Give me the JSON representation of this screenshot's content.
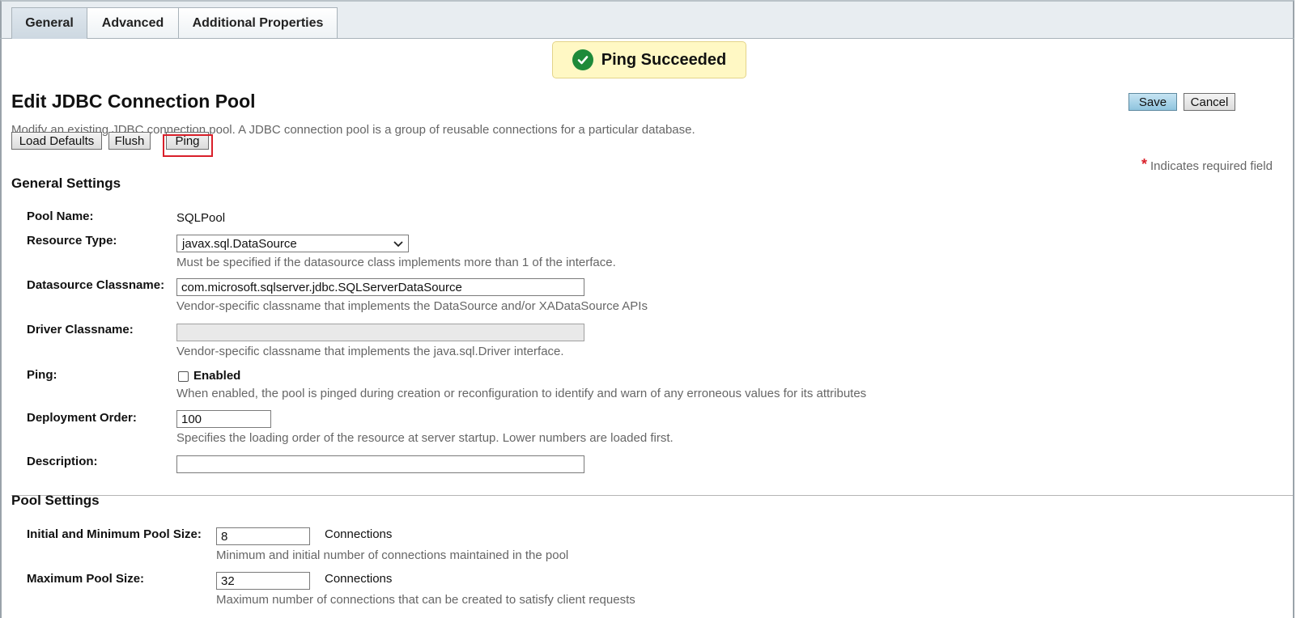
{
  "tabs": [
    {
      "label": "General",
      "active": true
    },
    {
      "label": "Advanced",
      "active": false
    },
    {
      "label": "Additional Properties",
      "active": false
    }
  ],
  "banner": {
    "text": "Ping Succeeded",
    "icon": "check-circle-icon",
    "color": "#1e8a3a"
  },
  "page": {
    "title": "Edit JDBC Connection Pool",
    "description": "Modify an existing JDBC connection pool. A JDBC connection pool is a group of reusable connections for a particular database."
  },
  "actions": {
    "save": "Save",
    "cancel": "Cancel",
    "load_defaults": "Load Defaults",
    "flush": "Flush",
    "ping": "Ping"
  },
  "required_note": {
    "star": "*",
    "text": "Indicates required field"
  },
  "general_settings": {
    "title": "General Settings",
    "pool_name": {
      "label": "Pool Name:",
      "value": "SQLPool"
    },
    "resource_type": {
      "label": "Resource Type:",
      "value": "javax.sql.DataSource",
      "help": "Must be specified if the datasource class implements more than 1 of the interface."
    },
    "datasource_classname": {
      "label": "Datasource Classname:",
      "value": "com.microsoft.sqlserver.jdbc.SQLServerDataSource",
      "help": "Vendor-specific classname that implements the DataSource and/or XADataSource APIs"
    },
    "driver_classname": {
      "label": "Driver Classname:",
      "value": "",
      "help": "Vendor-specific classname that implements the java.sql.Driver interface."
    },
    "ping": {
      "label": "Ping:",
      "checkbox_label": "Enabled",
      "checked": false,
      "help": "When enabled, the pool is pinged during creation or reconfiguration to identify and warn of any erroneous values for its attributes"
    },
    "deployment_order": {
      "label": "Deployment Order:",
      "value": "100",
      "help": "Specifies the loading order of the resource at server startup. Lower numbers are loaded first."
    },
    "description": {
      "label": "Description:",
      "value": ""
    }
  },
  "pool_settings": {
    "title": "Pool Settings",
    "initial_min_pool_size": {
      "label": "Initial and Minimum Pool Size:",
      "value": "8",
      "unit": "Connections",
      "help": "Minimum and initial number of connections maintained in the pool"
    },
    "max_pool_size": {
      "label": "Maximum Pool Size:",
      "value": "32",
      "unit": "Connections",
      "help": "Maximum number of connections that can be created to satisfy client requests"
    }
  }
}
